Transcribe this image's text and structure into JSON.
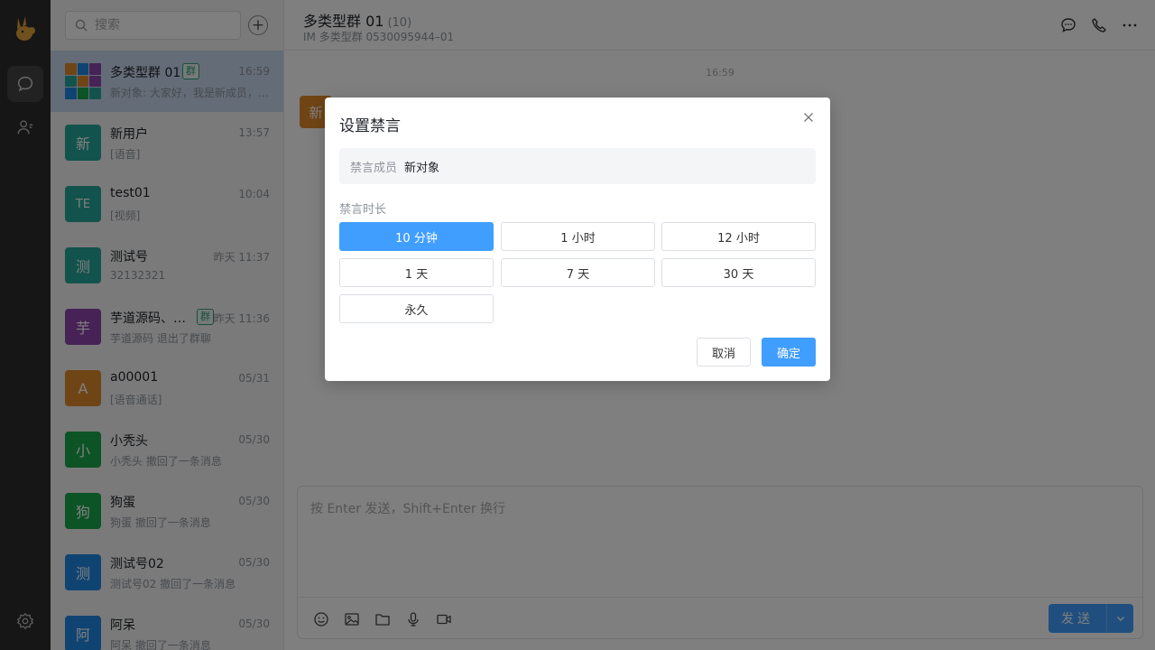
{
  "search": {
    "placeholder": "搜索"
  },
  "conversations": [
    {
      "name": "多类型群 01",
      "tag": "群",
      "time": "16:59",
      "preview": "新对象: 大家好，我是新成员，很高兴加入",
      "avatar": "",
      "color": ""
    },
    {
      "name": "新用户",
      "tag": "",
      "time": "13:57",
      "preview": "[语音]",
      "avatar": "新",
      "color": "#26a69a"
    },
    {
      "name": "test01",
      "tag": "",
      "time": "10:04",
      "preview": "[视频]",
      "avatar": "TE",
      "color": "#26a69a"
    },
    {
      "name": "测试号",
      "tag": "",
      "time": "昨天 11:37",
      "preview": "32132321",
      "avatar": "测",
      "color": "#26a69a"
    },
    {
      "name": "芋道源码、…",
      "tag": "群",
      "time": "昨天 11:36",
      "preview": "芋道源码 退出了群聊",
      "avatar": "芋",
      "color": "#8e44ad"
    },
    {
      "name": "a00001",
      "tag": "",
      "time": "05/31",
      "preview": "[语音通话]",
      "avatar": "A",
      "color": "#e08b2a"
    },
    {
      "name": "小秃头",
      "tag": "",
      "time": "05/30",
      "preview": "小秃头 撤回了一条消息",
      "avatar": "小",
      "color": "#19a64a"
    },
    {
      "name": "狗蛋",
      "tag": "",
      "time": "05/30",
      "preview": "狗蛋 撤回了一条消息",
      "avatar": "狗",
      "color": "#19a64a"
    },
    {
      "name": "测试号02",
      "tag": "",
      "time": "05/30",
      "preview": "测试号02 撤回了一条消息",
      "avatar": "测",
      "color": "#1e88e5"
    },
    {
      "name": "阿呆",
      "tag": "",
      "time": "05/30",
      "preview": "阿呆 撤回了一条消息",
      "avatar": "阿",
      "color": "#1e88e5"
    }
  ],
  "chat": {
    "title": "多类型群 01",
    "count": "(10)",
    "subtitle": "IM 多类型群 0530095944–01",
    "time": "16:59",
    "msg_avatar": "新",
    "composer_placeholder": "按 Enter 发送，Shift+Enter 换行",
    "send_label": "发送"
  },
  "dialog": {
    "title": "设置禁言",
    "member_label": "禁言成员",
    "member_name": "新对象",
    "duration_label": "禁言时长",
    "options": [
      "10 分钟",
      "1 小时",
      "12 小时",
      "1 天",
      "7 天",
      "30 天",
      "永久"
    ],
    "selected": "10 分钟",
    "cancel": "取消",
    "confirm": "确定"
  },
  "colors": {
    "accent": "#409eff",
    "selected_row": "#c9d9ef",
    "rail": "#2c2c2c"
  },
  "icons": [
    "logo-icon",
    "chat-icon",
    "contacts-icon",
    "settings-icon",
    "search-icon",
    "plus-icon",
    "comment-icon",
    "phone-icon",
    "more-icon",
    "emoji-icon",
    "image-icon",
    "folder-icon",
    "mic-icon",
    "video-icon",
    "close-icon",
    "chevron-down-icon"
  ]
}
